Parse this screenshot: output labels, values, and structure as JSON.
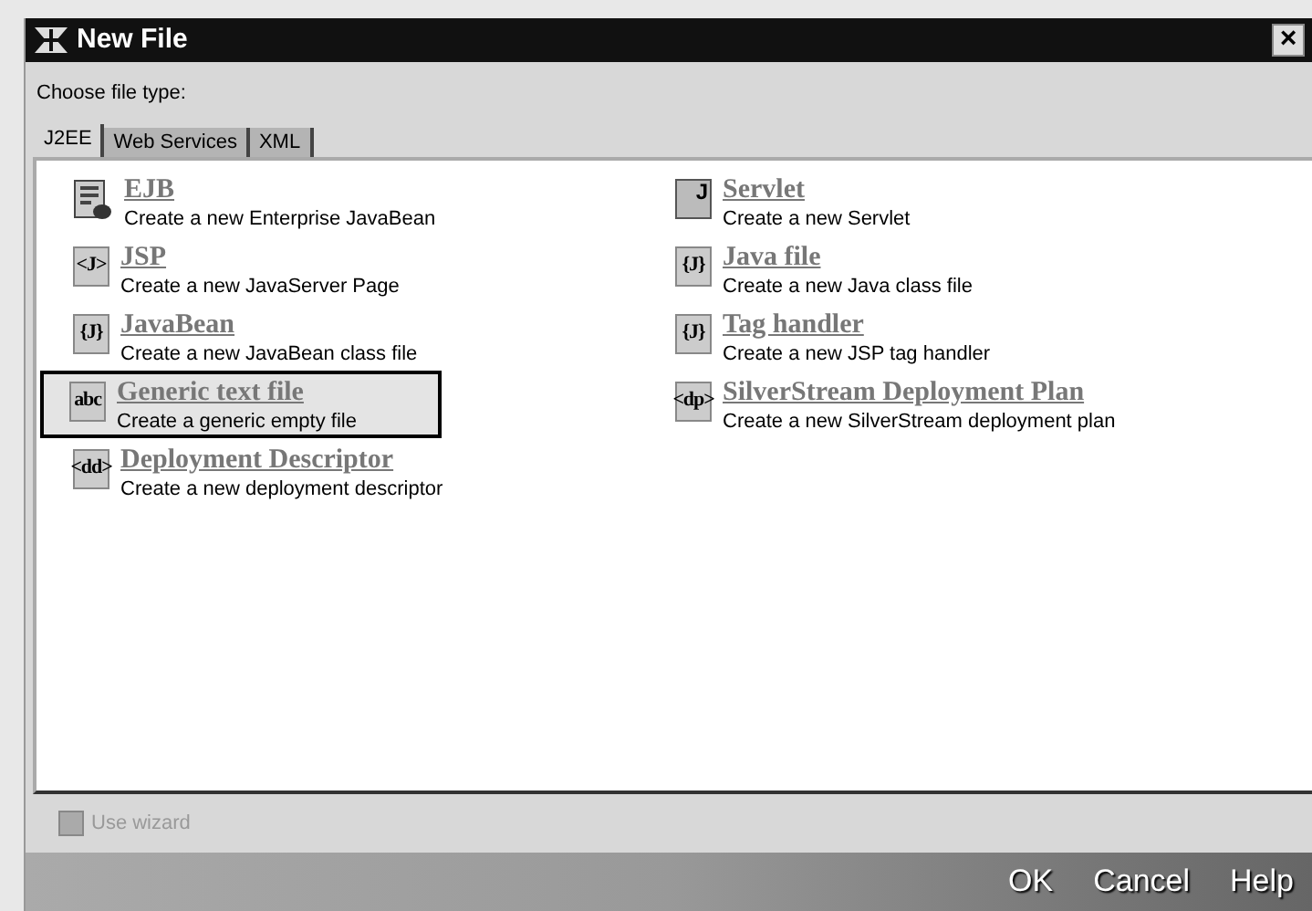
{
  "window": {
    "title": "New File",
    "close": "×"
  },
  "prompt": "Choose file type:",
  "tabs": [
    {
      "label": "J2EE",
      "selected": true
    },
    {
      "label": "Web Services",
      "selected": false
    },
    {
      "label": "XML",
      "selected": false
    }
  ],
  "columns": [
    [
      {
        "kind": "doc",
        "title": "EJB",
        "description": "Create a new Enterprise JavaBean",
        "selected": false
      },
      {
        "kind": "glyph",
        "glyph": "<J>",
        "title": "JSP",
        "description": "Create a new JavaServer Page",
        "selected": false
      },
      {
        "kind": "glyph",
        "glyph": "{J}",
        "title": "JavaBean",
        "description": "Create a new JavaBean class file",
        "selected": false
      },
      {
        "kind": "glyph",
        "glyph": "abc",
        "title": "Generic text file",
        "description": "Create a generic empty file",
        "selected": true
      },
      {
        "kind": "glyph",
        "glyph": "<dd>",
        "title": "Deployment Descriptor",
        "description": "Create a new deployment descriptor",
        "selected": false
      }
    ],
    [
      {
        "kind": "servlet",
        "glyph": "J",
        "title": "Servlet",
        "description": "Create a new Servlet",
        "selected": false
      },
      {
        "kind": "glyph",
        "glyph": "{J}",
        "title": "Java file",
        "description": "Create a new Java class file",
        "selected": false
      },
      {
        "kind": "glyph",
        "glyph": "{J}",
        "title": "Tag handler",
        "description": "Create a new JSP tag handler",
        "selected": false
      },
      {
        "kind": "glyph",
        "glyph": "<dp>",
        "title": "SilverStream Deployment Plan",
        "description": "Create a new SilverStream deployment plan",
        "selected": false
      }
    ]
  ],
  "use_wizard": {
    "label": "Use wizard",
    "checked": false,
    "disabled": true
  },
  "buttons": [
    "OK",
    "Cancel",
    "Help"
  ]
}
